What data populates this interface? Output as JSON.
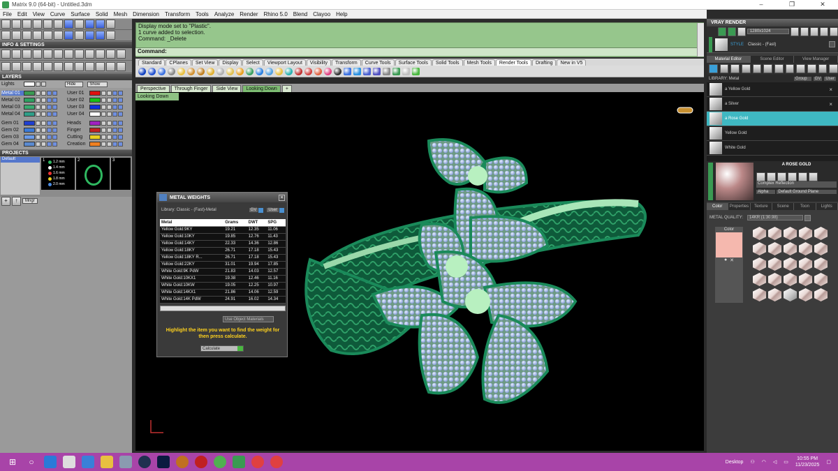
{
  "window": {
    "title": "Matrix 9.0 (64-bit) - Untitled.3dm",
    "min": "–",
    "max": "❐",
    "close": "✕"
  },
  "menu": [
    "File",
    "Edit",
    "View",
    "Curve",
    "Surface",
    "Solid",
    "Mesh",
    "Dimension",
    "Transform",
    "Tools",
    "Analyze",
    "Render",
    "Rhino 5.0",
    "Blend",
    "Clayoo",
    "Help"
  ],
  "left": {
    "info_header": "INFO & SETTINGS",
    "layers_header": "LAYERS",
    "lights_label": "Lights",
    "hide_label": "Hide",
    "show_label": "Show",
    "layers_left": [
      {
        "name": "Metal 01",
        "color": "#3a9a52",
        "sel": true
      },
      {
        "name": "Metal 02",
        "color": "#2fa060"
      },
      {
        "name": "Metal 03",
        "color": "#3aaa70"
      },
      {
        "name": "Metal 04",
        "color": "#2e9e88"
      },
      {
        "name": "Gem 01",
        "color": "#1f3fd0"
      },
      {
        "name": "Gem 02",
        "color": "#3a7ad8"
      },
      {
        "name": "Gem 03",
        "color": "#6a9ae8"
      },
      {
        "name": "Gem 04",
        "color": "#5a8ad0"
      }
    ],
    "layers_right": [
      {
        "name": "User 01",
        "color": "#e01010"
      },
      {
        "name": "User 02",
        "color": "#18c018"
      },
      {
        "name": "User 03",
        "color": "#1030e0"
      },
      {
        "name": "User 04",
        "color": "#ffffff"
      },
      {
        "name": "Heads",
        "color": "#a020c0"
      },
      {
        "name": "Finger",
        "color": "#c02020"
      },
      {
        "name": "Cutting",
        "color": "#e8d020"
      },
      {
        "name": "Creation",
        "color": "#f08020"
      }
    ],
    "projects_header": "PROJECTS",
    "projects_default": "Default",
    "project_sizes": [
      "1.2 mm",
      "1.4 mm",
      "1.6 mm",
      "1.8 mm",
      "2.0 mm"
    ],
    "project_nums": [
      "1",
      "2",
      "3"
    ],
    "mngr": "Mngr"
  },
  "command": {
    "lines": [
      "Display mode set to \"Plastic\".",
      "1 curve added to selection.",
      "Command: _Delete"
    ],
    "prompt": "Command:"
  },
  "toolbar_tabs": [
    "Standard",
    "CPlanes",
    "Set View",
    "Display",
    "Select",
    "Viewport Layout",
    "Visibility",
    "Transform",
    "Curve Tools",
    "Surface Tools",
    "Solid Tools",
    "Mesh Tools",
    "Render Tools",
    "Drafting",
    "New in V5"
  ],
  "toolbar_active": "Render Tools",
  "viewport_tabs": [
    "Perspective",
    "Through Finger",
    "Side View",
    "Looking Down"
  ],
  "viewport_active": "Looking Down",
  "viewport_label": "Looking Down",
  "metal_weights": {
    "title": "METAL WEIGHTS",
    "library": "Library: Classic - (Fast)-Metal",
    "gv": "GV",
    "user": "User",
    "columns": [
      "Metal",
      "Grams",
      "DWT",
      "SPG"
    ],
    "rows": [
      [
        "Yellow Gold:9KY",
        "19.21",
        "12.35",
        "11.06"
      ],
      [
        "Yellow Gold:10KY",
        "19.85",
        "12.76",
        "11.43"
      ],
      [
        "Yellow Gold:14KY",
        "22.33",
        "14.36",
        "12.86"
      ],
      [
        "Yellow Gold:18KY",
        "26.71",
        "17.18",
        "15.43"
      ],
      [
        "Yellow Gold:18KY R...",
        "26.71",
        "17.18",
        "15.43"
      ],
      [
        "Yellow Gold:22KY",
        "31.01",
        "19.94",
        "17.85"
      ],
      [
        "White Gold:9K PdW",
        "21.83",
        "14.03",
        "12.57"
      ],
      [
        "White Gold:10KX1",
        "19.38",
        "12.46",
        "11.16"
      ],
      [
        "White Gold:10KW",
        "19.05",
        "12.25",
        "10.97"
      ],
      [
        "White Gold:14KX1",
        "21.86",
        "14.06",
        "12.59"
      ],
      [
        "White Gold:14K PdW",
        "24.91",
        "16.02",
        "14.34"
      ]
    ],
    "use_object": "Use Object Materials",
    "hint": "Highlight the item you want to find the weight for then press calculate.",
    "calculate": "Calculate"
  },
  "right": {
    "vray_header": "VRAY RENDER",
    "resolution": "1280x1024",
    "style_label": "STYLE",
    "style_value": "Classic - (Fast)",
    "tabs": [
      "Material Editor",
      "Scene Editor",
      "View Manager"
    ],
    "library_label": "LIBRARY: Metal",
    "group_label": "Group",
    "gv": "GV",
    "user": "User",
    "materials": [
      {
        "name": "a Yellow Gold",
        "x": "×"
      },
      {
        "name": "a Silver",
        "x": "×"
      },
      {
        "name": "a Rose Gold",
        "sel": true
      },
      {
        "name": "Yellow Gold"
      },
      {
        "name": "White Gold"
      }
    ],
    "preview_title": "A ROSE GOLD",
    "reflection": "Complex Reflection",
    "alpha": "Alpha",
    "ground": "Default Ground Plane",
    "subtabs": [
      "Color",
      "Properties",
      "Texture",
      "Scene",
      "Toon",
      "Lights"
    ],
    "metal_quality_label": "METAL QUALITY:",
    "metal_quality_value": "14KR   (1:30.98)",
    "color_label": "Color",
    "swatch_color": "#f5b8ae"
  },
  "taskbar": {
    "desktop": "Desktop",
    "time": "10:55 PM",
    "date": "11/23/2025"
  }
}
